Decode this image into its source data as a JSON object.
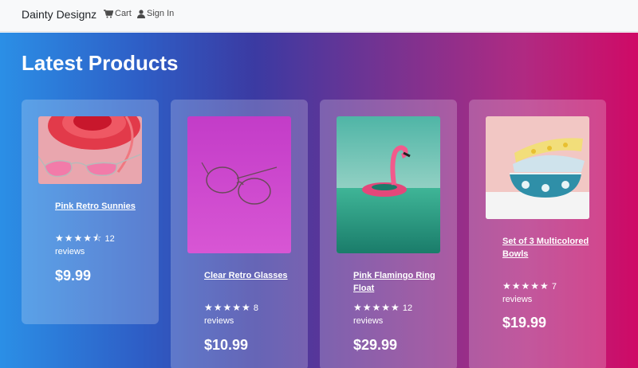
{
  "nav": {
    "brand": "Dainty Designz",
    "cart_label": "Cart",
    "signin_label": "Sign In"
  },
  "hero": {
    "title": "Latest Products"
  },
  "products": [
    {
      "name": "Pink Retro Sunnies",
      "rating": 4.5,
      "reviews_count": "12",
      "reviews_label": "reviews",
      "price": "$9.99"
    },
    {
      "name": "Clear Retro Glasses",
      "rating": 5,
      "reviews_count": "8",
      "reviews_label": "reviews",
      "price": "$10.99"
    },
    {
      "name": "Pink Flamingo Ring Float",
      "rating": 5,
      "reviews_count": "12",
      "reviews_label": "reviews",
      "price": "$29.99"
    },
    {
      "name": "Set of 3 Multicolored Bowls",
      "rating": 5,
      "reviews_count": "7",
      "reviews_label": "reviews",
      "price": "$19.99"
    }
  ],
  "colors": {
    "gradient_start": "#2b8fe6",
    "gradient_end": "#cf0a66",
    "navbar_bg": "#f8f9fa",
    "text_white": "#ffffff"
  }
}
